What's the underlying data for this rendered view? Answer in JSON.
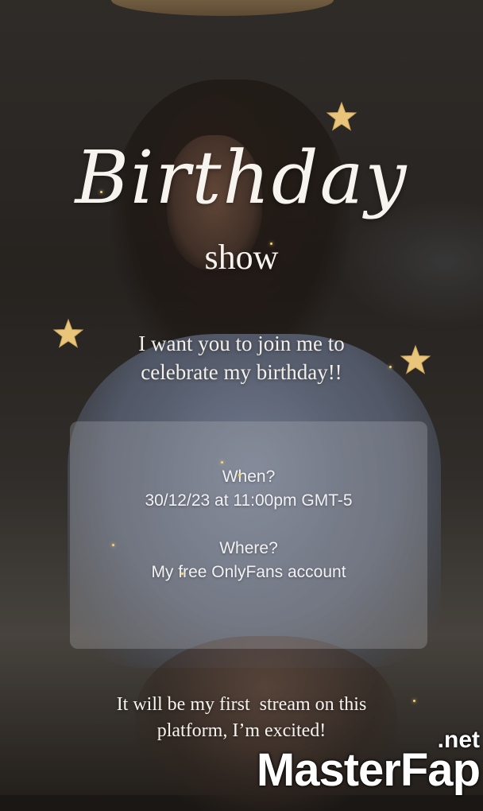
{
  "flyer": {
    "title": "Birthday",
    "subtitle": "show",
    "invite_lines": [
      "I want you to join me to",
      "celebrate my birthday!!"
    ],
    "details": {
      "when_label": "When?",
      "when_value": "30/12/23 at 11:00pm GMT-5",
      "where_label": "Where?",
      "where_value": "My free OnlyFans account"
    },
    "footer_lines": [
      "It will be my first  stream on this",
      "platform, I’m excited!"
    ]
  },
  "watermark": {
    "suffix": ".net",
    "brand": "MasterFap"
  },
  "colors": {
    "text": "#f7f3ef",
    "star_gold": "#e8c57a",
    "card_bg": "rgba(190,190,195,0.28)"
  },
  "icons": [
    "star-icon"
  ]
}
